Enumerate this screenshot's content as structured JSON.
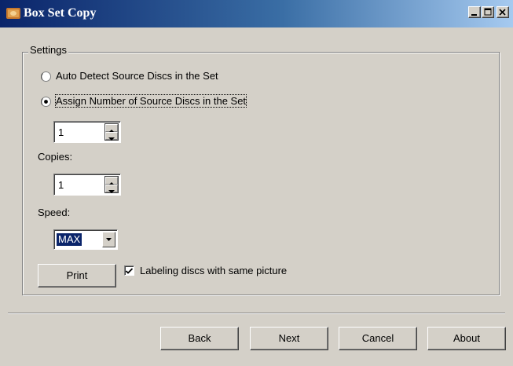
{
  "window": {
    "title": "Box Set Copy",
    "icon": "app-disc-icon"
  },
  "settings": {
    "group_label": "Settings",
    "radio_auto_label": "Auto Detect Source Discs in the Set",
    "radio_assign_label": "Assign Number of Source Discs in the Set",
    "selected_radio": "assign",
    "source_discs_value": "1",
    "copies_label": "Copies:",
    "copies_value": "1",
    "speed_label": "Speed:",
    "speed_value": "MAX",
    "print_button": {
      "mnemonic": "P",
      "rest": "rint"
    },
    "labeling_checkbox_label": "Labeling discs with same picture",
    "labeling_checked": true
  },
  "footer": {
    "back": {
      "mnemonic": "B",
      "rest": "ack"
    },
    "next": {
      "mnemonic": "N",
      "rest": "ext"
    },
    "cancel": {
      "mnemonic": "C",
      "rest": "ancel"
    },
    "about": {
      "mnemonic": "A",
      "rest": "bout"
    }
  },
  "colors": {
    "titlebar_start": "#0a246a",
    "titlebar_end": "#a6caf0",
    "face": "#d4d0c8",
    "selection": "#0a246a"
  }
}
